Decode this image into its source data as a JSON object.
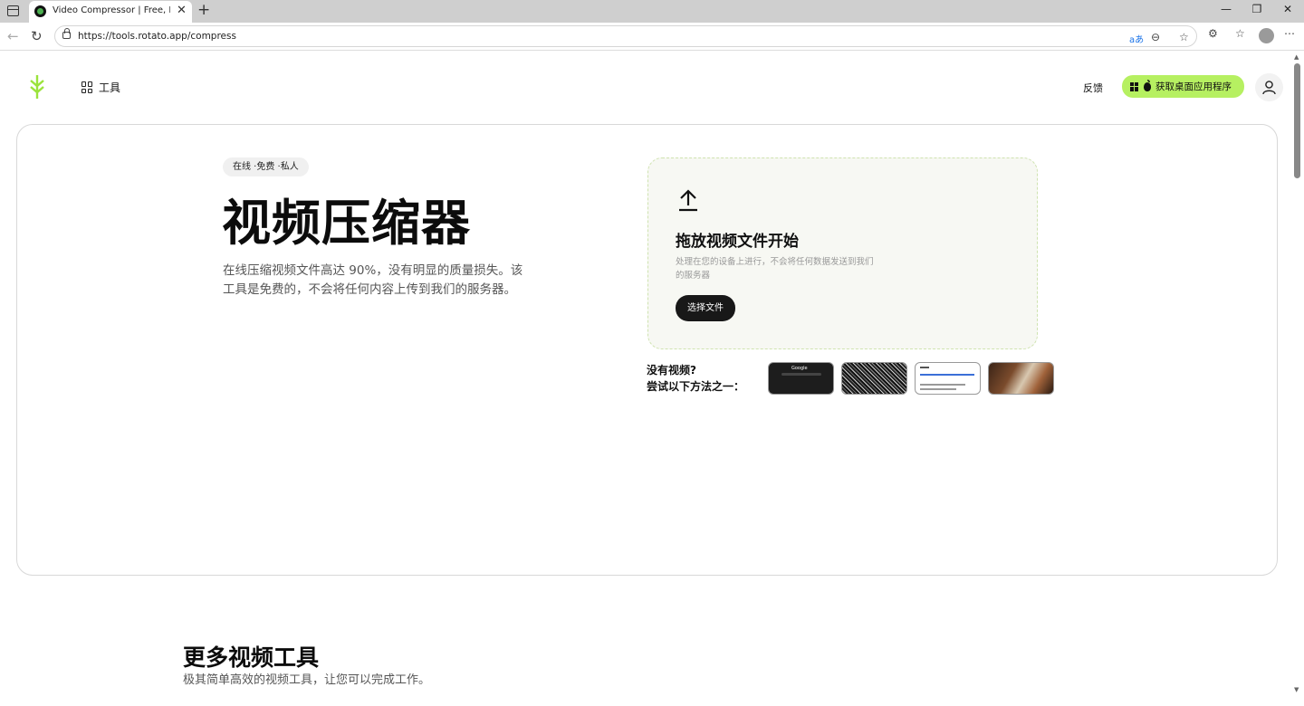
{
  "browser": {
    "tab_title": "Video Compressor | Free, Private,",
    "tab_close": "✕",
    "new_tab": "+",
    "url": "https://tools.rotato.app/compress",
    "window_controls": {
      "minimize": "—",
      "restore": "❐",
      "close": "✕"
    }
  },
  "header": {
    "tools_label": "工具",
    "feedback_label": "反馈",
    "desktop_app_label": "获取桌面应用程序",
    "brand_color": "#b6f061"
  },
  "hero": {
    "badge": "在线 ·免费 ·私人",
    "title": "视频压缩器",
    "description": "在线压缩视频文件高达 90%，没有明显的质量损失。该工具是免费的，不会将任何内容上传到我们的服务器。"
  },
  "upload": {
    "title": "拖放视频文件开始",
    "subtitle": "处理在您的设备上进行，不会将任何数据发送到我们的服务器",
    "button": "选择文件"
  },
  "samples": {
    "prompt_line1": "没有视频?",
    "prompt_line2": "尝试以下方法之一：",
    "sample1_label": "Google"
  },
  "more_tools": {
    "title": "更多视频工具",
    "subtitle": "极其简单高效的视频工具，让您可以完成工作。"
  }
}
